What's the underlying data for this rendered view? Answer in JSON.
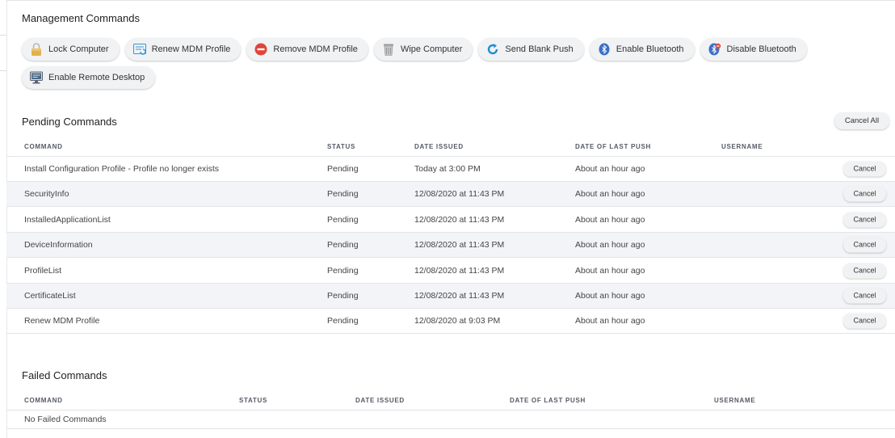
{
  "management": {
    "title": "Management Commands",
    "buttons": [
      {
        "label": "Lock Computer",
        "icon": "lock-icon"
      },
      {
        "label": "Renew MDM Profile",
        "icon": "renew-profile-icon"
      },
      {
        "label": "Remove MDM Profile",
        "icon": "remove-icon"
      },
      {
        "label": "Wipe Computer",
        "icon": "trash-icon"
      },
      {
        "label": "Send Blank Push",
        "icon": "refresh-icon"
      },
      {
        "label": "Enable Bluetooth",
        "icon": "bluetooth-icon"
      },
      {
        "label": "Disable Bluetooth",
        "icon": "bluetooth-disabled-icon"
      },
      {
        "label": "Enable Remote Desktop",
        "icon": "remote-desktop-icon"
      }
    ]
  },
  "pending": {
    "title": "Pending Commands",
    "cancel_all_label": "Cancel All",
    "columns": [
      "COMMAND",
      "STATUS",
      "DATE ISSUED",
      "DATE OF LAST PUSH",
      "USERNAME"
    ],
    "cancel_label": "Cancel",
    "rows": [
      {
        "command": "Install Configuration Profile - Profile no longer exists",
        "status": "Pending",
        "date_issued": "Today at 3:00 PM",
        "last_push": "About an hour ago",
        "username": ""
      },
      {
        "command": "SecurityInfo",
        "status": "Pending",
        "date_issued": "12/08/2020 at 11:43 PM",
        "last_push": "About an hour ago",
        "username": ""
      },
      {
        "command": "InstalledApplicationList",
        "status": "Pending",
        "date_issued": "12/08/2020 at 11:43 PM",
        "last_push": "About an hour ago",
        "username": ""
      },
      {
        "command": "DeviceInformation",
        "status": "Pending",
        "date_issued": "12/08/2020 at 11:43 PM",
        "last_push": "About an hour ago",
        "username": ""
      },
      {
        "command": "ProfileList",
        "status": "Pending",
        "date_issued": "12/08/2020 at 11:43 PM",
        "last_push": "About an hour ago",
        "username": ""
      },
      {
        "command": "CertificateList",
        "status": "Pending",
        "date_issued": "12/08/2020 at 11:43 PM",
        "last_push": "About an hour ago",
        "username": ""
      },
      {
        "command": "Renew MDM Profile",
        "status": "Pending",
        "date_issued": "12/08/2020 at 9:03 PM",
        "last_push": "About an hour ago",
        "username": ""
      }
    ]
  },
  "failed": {
    "title": "Failed Commands",
    "columns": [
      "COMMAND",
      "STATUS",
      "DATE ISSUED",
      "DATE OF LAST PUSH",
      "USERNAME"
    ],
    "empty_text": "No Failed Commands"
  }
}
